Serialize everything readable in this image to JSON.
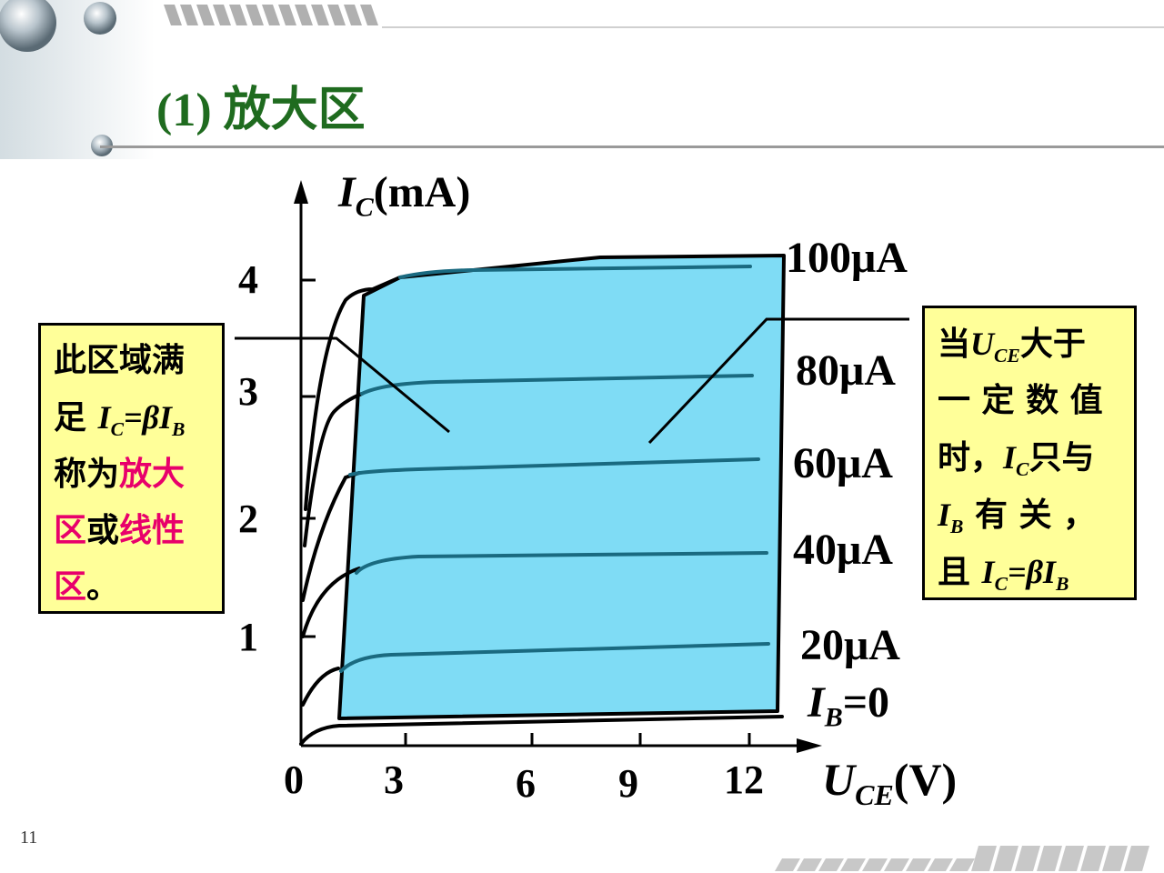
{
  "slide": {
    "title_prefix": "(1)",
    "title_main": "放大区",
    "page_number": "11"
  },
  "axes": {
    "y_label_var": "I",
    "y_label_sub": "C",
    "y_label_unit": "(mA)",
    "y_ticks": [
      "4",
      "3",
      "2",
      "1"
    ],
    "x_origin": "0",
    "x_ticks": [
      "3",
      "6",
      "9",
      "12"
    ],
    "x_label_var": "U",
    "x_label_sub": "CE",
    "x_label_unit": "(V)"
  },
  "curve_labels": {
    "ib100": "100μA",
    "ib80": "80μA",
    "ib60": "60μA",
    "ib40": "40μA",
    "ib20": "20μA",
    "ib0_var": "I",
    "ib0_sub": "B",
    "ib0_value": "=0"
  },
  "left_note": {
    "line1": "此区域满",
    "line2_prefix": "足",
    "ic_var": "I",
    "ic_sub": "C",
    "eq_beta": "=β",
    "ib_var": "I",
    "ib_sub": "B",
    "line3_prefix": "称为",
    "line3_highlight": "放大",
    "line4_highlight1": "区",
    "line4_mid": "或",
    "line4_highlight2": "线性",
    "line5_highlight": "区",
    "line5_suffix": "。"
  },
  "right_note": {
    "line1_prefix": "当",
    "uce_var": "U",
    "uce_sub": "CE",
    "line1_suffix": "大于",
    "line2": "一 定 数 值",
    "line3_prefix": "时，",
    "ic_var": "I",
    "ic_sub": "C",
    "line3_suffix": "只与",
    "ib_var": "I",
    "ib_sub": "B",
    "line4_suffix": " 有 关 ，",
    "line5_prefix": "且 ",
    "ic2_var": "I",
    "ic2_sub": "C",
    "eq_beta": "=β",
    "ib2_var": "I",
    "ib2_sub": "B"
  },
  "colors": {
    "title": "#1f6b1f",
    "region_fill": "#7fdcf5",
    "curve_color": "#1a6a80",
    "note_bg": "#ffff99",
    "highlight": "#e8006b"
  }
}
